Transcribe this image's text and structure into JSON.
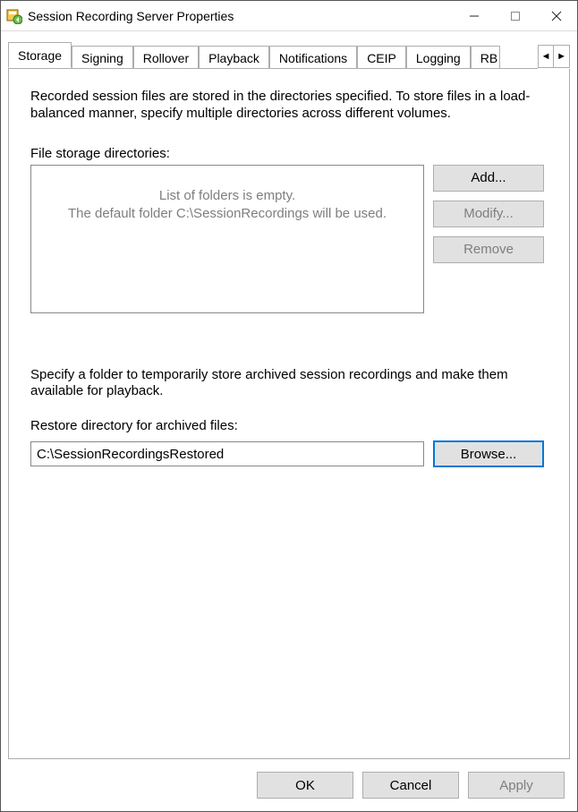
{
  "window": {
    "title": "Session Recording Server Properties"
  },
  "tabs": {
    "items": [
      "Storage",
      "Signing",
      "Rollover",
      "Playback",
      "Notifications",
      "CEIP",
      "Logging",
      "RB"
    ],
    "activeIndex": 0
  },
  "storage": {
    "description": "Recorded session files are stored in the directories specified. To store files in a load-balanced manner, specify multiple directories across different volumes.",
    "fileStorageLabel": "File storage directories:",
    "emptyLine1": "List of folders is empty.",
    "emptyLine2": "The default folder C:\\SessionRecordings will be used.",
    "addLabel": "Add...",
    "modifyLabel": "Modify...",
    "removeLabel": "Remove",
    "restoreDescription": "Specify a folder to temporarily store archived session recordings and make them available for playback.",
    "restoreLabel": "Restore directory for archived files:",
    "restoreValue": "C:\\SessionRecordingsRestored",
    "browseLabel": "Browse..."
  },
  "footer": {
    "ok": "OK",
    "cancel": "Cancel",
    "apply": "Apply"
  }
}
